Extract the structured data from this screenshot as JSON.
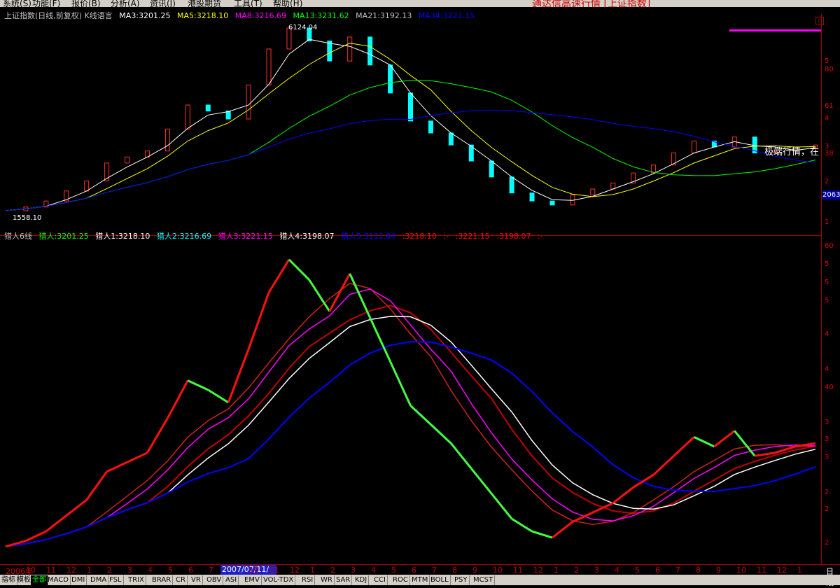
{
  "menu": {
    "items": [
      "系统(S)",
      "功能(F)",
      "报价(B)",
      "分析(A)",
      "资讯(J)",
      "港股期货",
      "工具(T)",
      "帮助(H)"
    ],
    "promo": "通达信高速行情 [上证指数]"
  },
  "main_chart": {
    "title": "上证指数(日线,前复权) K线语言",
    "ma": [
      {
        "label": "MA3:3201.25",
        "color": "#ffffff"
      },
      {
        "label": "MA5:3218.10",
        "color": "#ffff00"
      },
      {
        "label": "MA8:3216.69",
        "color": "#ff00ff"
      },
      {
        "label": "MA13:3231.62",
        "color": "#00ff00"
      },
      {
        "label": "MA21:3192.13",
        "color": "#c0c0c0"
      },
      {
        "label": "MA34:3221.15",
        "color": "#0000ff"
      }
    ],
    "high_label": "6124.04",
    "low_label": "1558.10",
    "overlay": "极端行情，在",
    "price_tag": "2063",
    "right_axis": [
      "5",
      "80",
      "61",
      "4",
      "3",
      "38",
      "2",
      "1"
    ]
  },
  "sub_chart": {
    "title": "猎人6线",
    "lines": [
      {
        "label": "猎人:3201.25",
        "color": "#00ff00"
      },
      {
        "label": "猎人1:3218.10",
        "color": "#ffffff"
      },
      {
        "label": "猎人2:3216.69",
        "color": "#00ffff"
      },
      {
        "label": "猎人3:3221.15",
        "color": "#ff00ff"
      },
      {
        "label": "猎人4:3198.07",
        "color": "#ffffff"
      },
      {
        "label": "猎人5:3112.84",
        "color": "#0000ff"
      },
      {
        "label": ":3218.10",
        "color": "#ff0000"
      },
      {
        "label": ":-",
        "color": "#ff0000"
      },
      {
        "label": ":3221.15",
        "color": "#ff0000"
      },
      {
        "label": ":3198.07",
        "color": "#ff0000"
      },
      {
        "label": ":-",
        "color": "#ff0000"
      }
    ],
    "right_axis": [
      "60",
      "5",
      "5",
      "5",
      "4",
      "4",
      "40",
      "3",
      "3",
      "3",
      "2",
      "2",
      "2"
    ]
  },
  "x_axis": {
    "labels": [
      "2006年",
      "10",
      "11",
      "12",
      "1",
      "2",
      "3",
      "4",
      "5",
      "6",
      "7",
      "2007/07/11/三",
      "10",
      "11",
      "12",
      "1",
      "2",
      "3",
      "4",
      "5",
      "6",
      "7",
      "8",
      "9",
      "10",
      "11",
      "12",
      "1",
      "2",
      "3",
      "4",
      "5",
      "6",
      "7",
      "8",
      "9",
      "10",
      "11",
      "12",
      "1"
    ],
    "right": "日线"
  },
  "tabs": [
    "指标",
    "模板",
    "全部",
    "MACD",
    "DMI",
    "DMA",
    "FSL",
    "TRIX",
    "BRAR",
    "CR",
    "VR",
    "OBV",
    "ASI",
    "EMV",
    "VOL-TDX",
    "RSI",
    "WR",
    "SAR",
    "KDJ",
    "CCI",
    "ROC",
    "MTM",
    "BOLL",
    "PSY",
    "MCST"
  ],
  "chart_data": {
    "type": "line",
    "series": [
      {
        "name": "上证指数",
        "values": [
          1558,
          1650,
          1800,
          2050,
          2300,
          2750,
          2900,
          3050,
          3600,
          4200,
          4050,
          3850,
          4700,
          5600,
          6124,
          5800,
          5300,
          5900,
          5200,
          4500,
          3800,
          3500,
          3200,
          2800,
          2400,
          2000,
          1800,
          1700,
          1950,
          2100,
          2250,
          2500,
          2700,
          3000,
          3300,
          3150,
          3400,
          3000,
          3050,
          3150,
          3200
        ]
      }
    ]
  }
}
